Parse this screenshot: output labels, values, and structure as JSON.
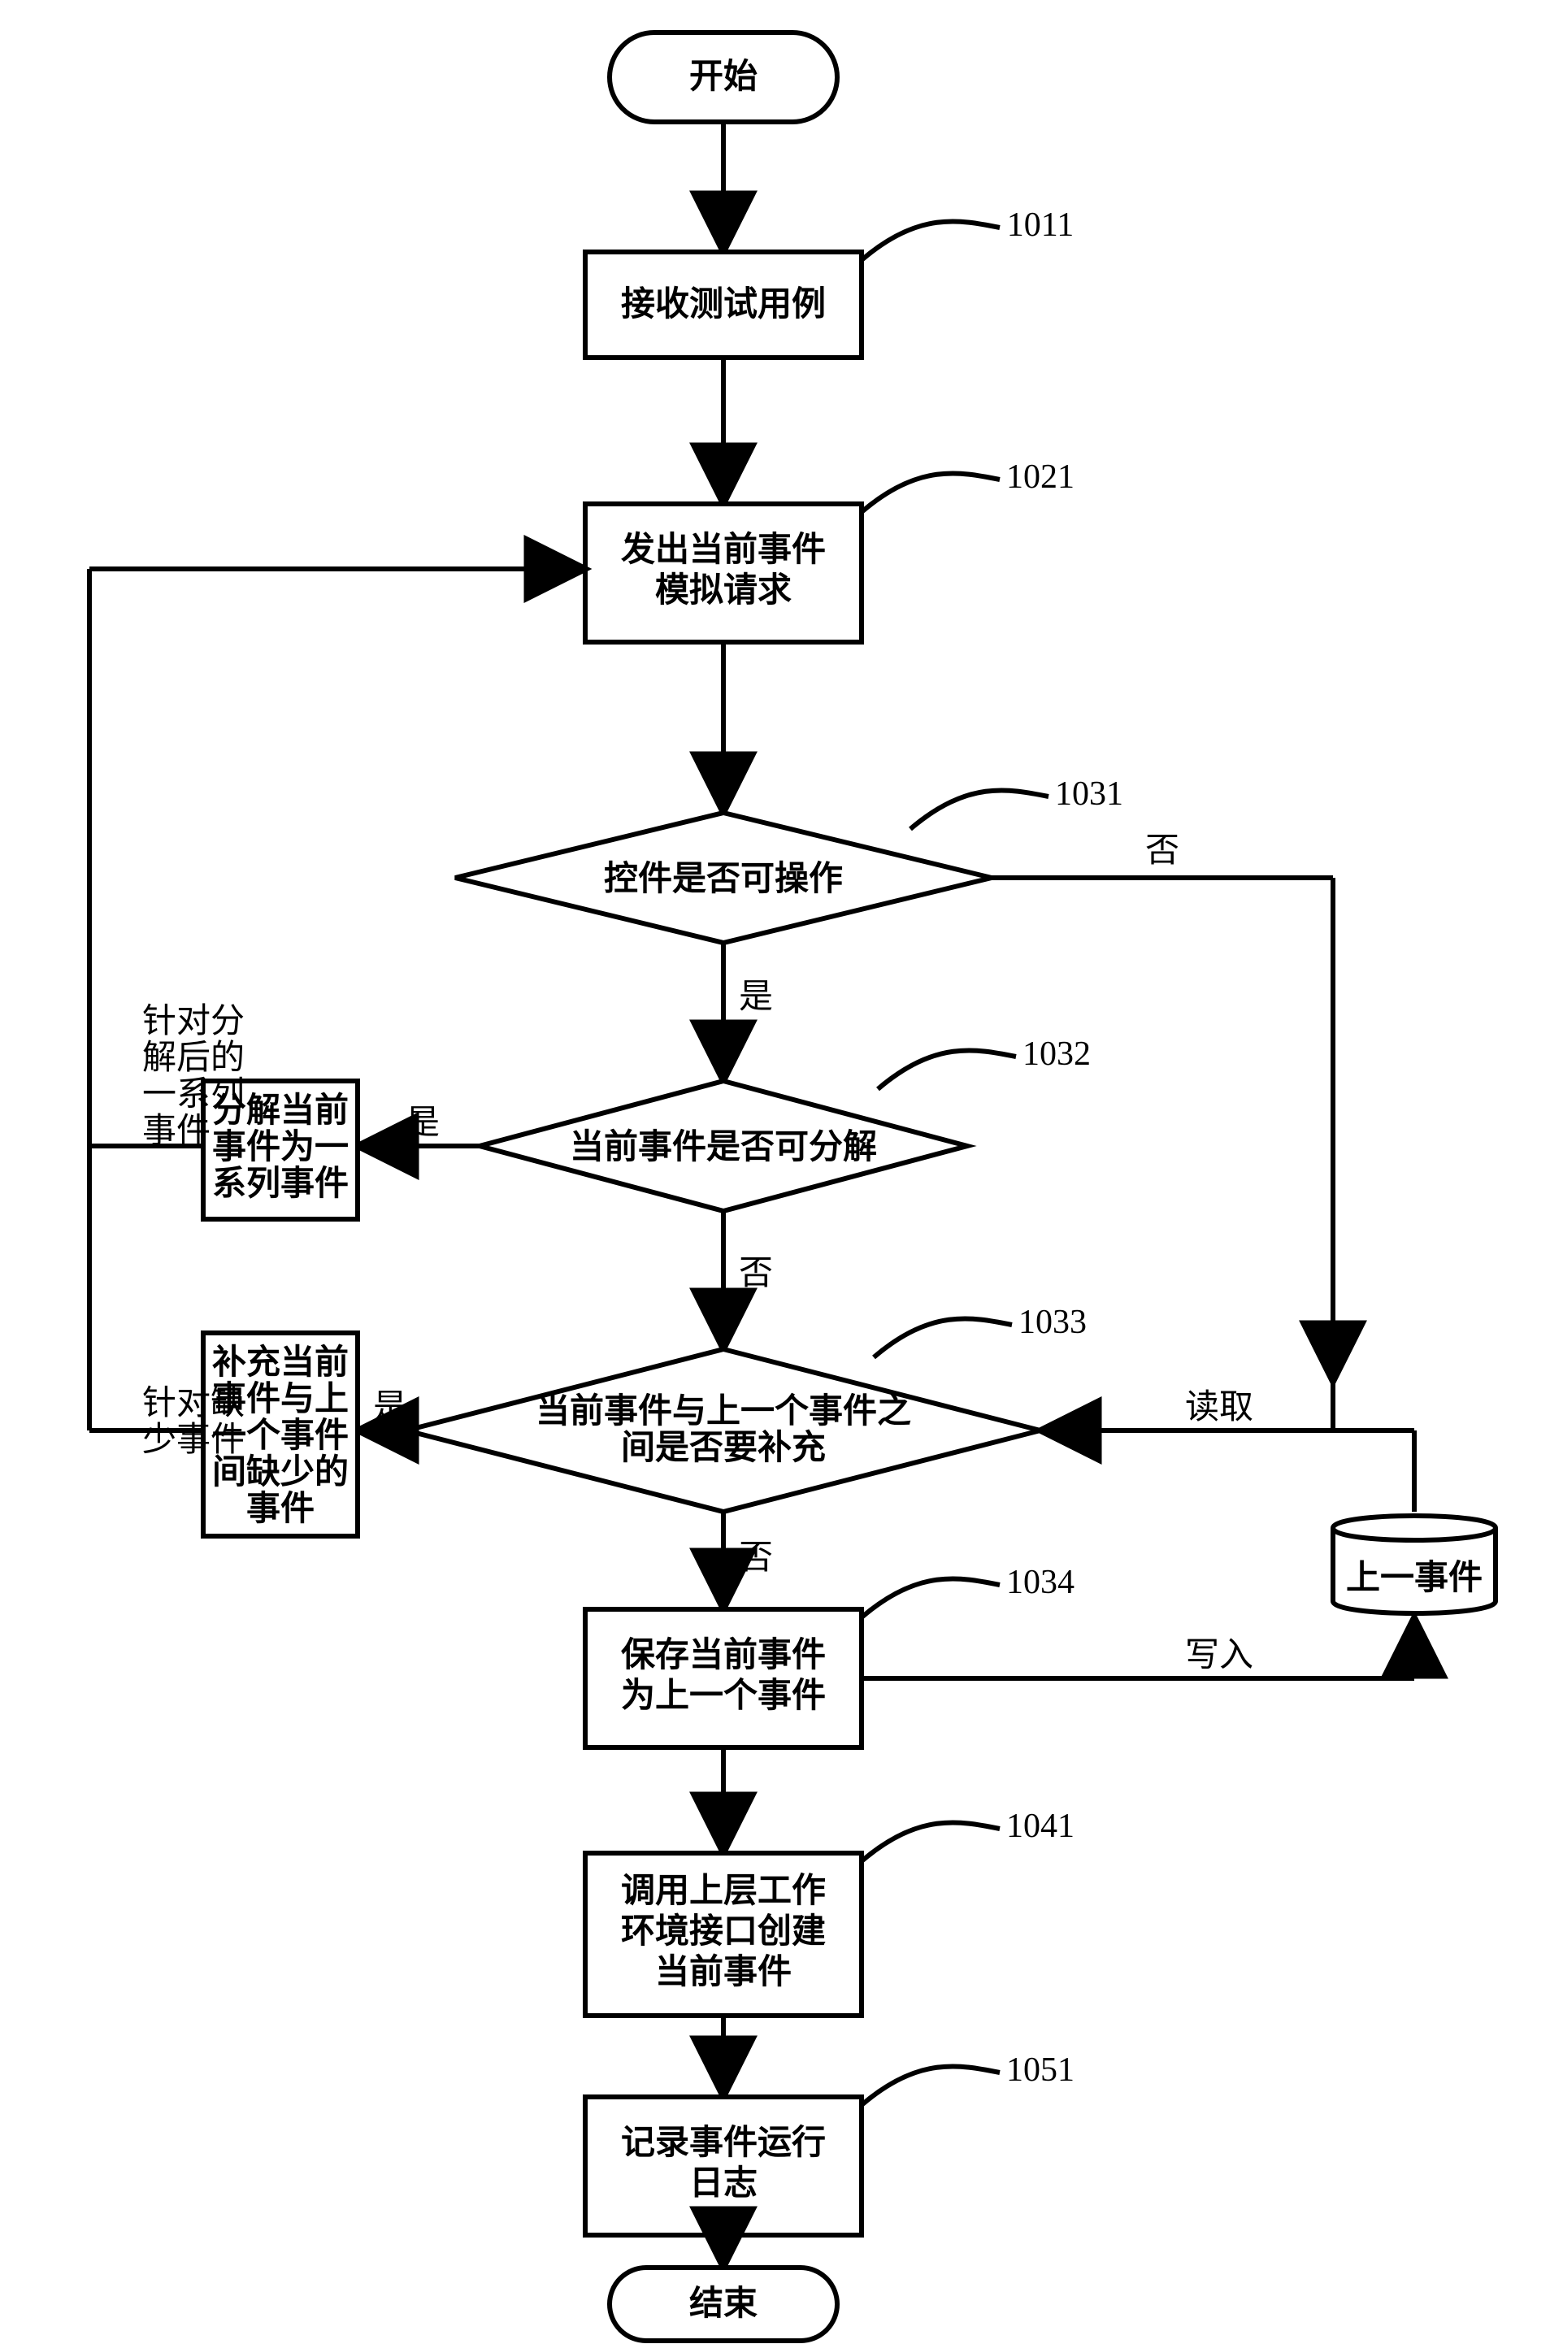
{
  "flow": {
    "start": "开始",
    "end": "结束",
    "steps": {
      "s1011": {
        "label": "1011",
        "text": "接收测试用例"
      },
      "s1021": {
        "label": "1021",
        "text_line1": "发出当前事件",
        "text_line2": "模拟请求"
      },
      "s1031": {
        "label": "1031",
        "text": "控件是否可操作"
      },
      "s1032": {
        "label": "1032",
        "text": "当前事件是否可分解"
      },
      "decompose_box": {
        "line1": "分解当前",
        "line2": "事件为一",
        "line3": "系列事件"
      },
      "decompose_side": {
        "line1": "针对分",
        "line2": "解后的",
        "line3": "一系列",
        "line4": "事件"
      },
      "s1033": {
        "label": "1033",
        "line1": "当前事件与上一个事件之",
        "line2": "间是否要补充"
      },
      "supplement_box": {
        "line1": "补充当前",
        "line2": "事件与上",
        "line3": "一个事件",
        "line4": "间缺少的",
        "line5": "事件"
      },
      "supplement_side": {
        "line1": "针对缺",
        "line2": "少事件"
      },
      "s1034": {
        "label": "1034",
        "line1": "保存当前事件",
        "line2": "为上一个事件"
      },
      "s1041": {
        "label": "1041",
        "line1": "调用上层工作",
        "line2": "环境接口创建",
        "line3": "当前事件"
      },
      "s1051": {
        "label": "1051",
        "line1": "记录事件运行",
        "line2": "日志"
      }
    },
    "labels": {
      "yes": "是",
      "no": "否",
      "read": "读取",
      "write": "写入"
    },
    "datastore": {
      "text": "上一事件"
    }
  }
}
